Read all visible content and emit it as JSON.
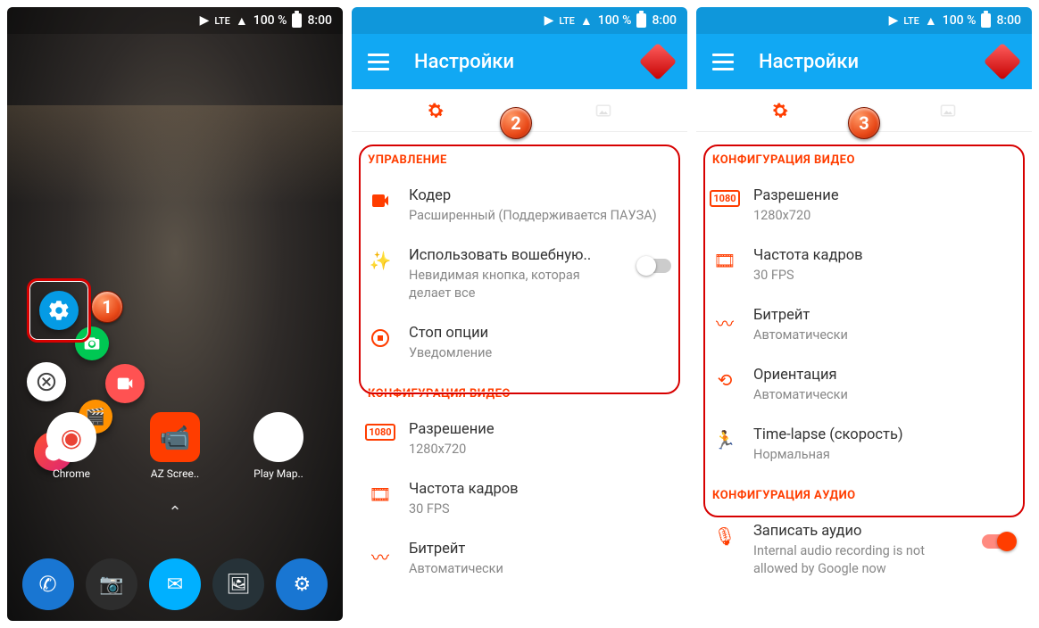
{
  "status": {
    "lte": "LTE",
    "battery": "100 %",
    "time": "8:00"
  },
  "home": {
    "apps": {
      "chrome": "Chrome",
      "az": "AZ Scree..",
      "play": "Play Мар.."
    }
  },
  "settings": {
    "title": "Настройки",
    "sections": {
      "control": {
        "header": "УПРАВЛЕНИЕ",
        "coder": {
          "title": "Кодер",
          "sub": "Расширенный (Поддерживается ПАУЗА)"
        },
        "magic": {
          "title": "Использовать вошебную..",
          "sub": "Невидимая кнопка, которая делает все"
        },
        "stop": {
          "title": "Стоп опции",
          "sub": "Уведомление"
        }
      },
      "video": {
        "header": "КОНФИГУРАЦИЯ ВИДЕО",
        "res": {
          "title": "Разрешение",
          "sub": "1280x720"
        },
        "fps": {
          "title": "Частота кадров",
          "sub": "30 FPS"
        },
        "bitr": {
          "title": "Битрейт",
          "sub": "Автоматически"
        },
        "orient": {
          "title": "Ориентация",
          "sub": "Автоматически"
        },
        "lapse": {
          "title": "Time-lapse (скорость)",
          "sub": "Нормальная"
        }
      },
      "audio": {
        "header": "КОНФИГУРАЦИЯ АУДИО",
        "rec": {
          "title": "Записать аудио",
          "sub": "Internal audio recording is not allowed by Google now"
        }
      }
    }
  },
  "steps": {
    "s1": "1",
    "s2": "2",
    "s3": "3"
  }
}
